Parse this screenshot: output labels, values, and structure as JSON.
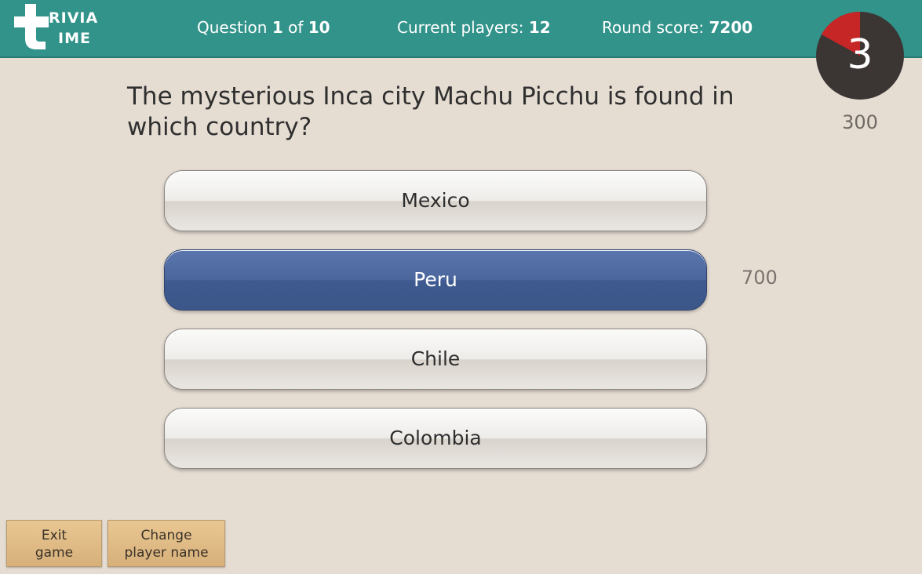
{
  "logo": {
    "line1": "RIVIA",
    "line2": "IME"
  },
  "header": {
    "question_prefix": "Question ",
    "question_current": "1",
    "question_middle": " of ",
    "question_total": "10",
    "players_label": "Current players: ",
    "players_value": "12",
    "score_label": "Round score: ",
    "score_value": "7200"
  },
  "timer": {
    "seconds": "3",
    "points": "300",
    "remaining_fraction": 0.17
  },
  "question": {
    "text": "The mysterious Inca city Machu Picchu is found in which country?"
  },
  "answers": [
    {
      "label": "Mexico"
    },
    {
      "label": "Peru"
    },
    {
      "label": "Chile"
    },
    {
      "label": "Colombia"
    }
  ],
  "selected_answer_points": "700",
  "buttons": {
    "exit_line1": "Exit",
    "exit_line2": "game",
    "change_line1": "Change",
    "change_line2": "player name"
  },
  "colors": {
    "header_bg": "#32938a",
    "selected_answer": "#3f5a90",
    "timer_red": "#c62626",
    "timer_dark": "#3b3634"
  }
}
